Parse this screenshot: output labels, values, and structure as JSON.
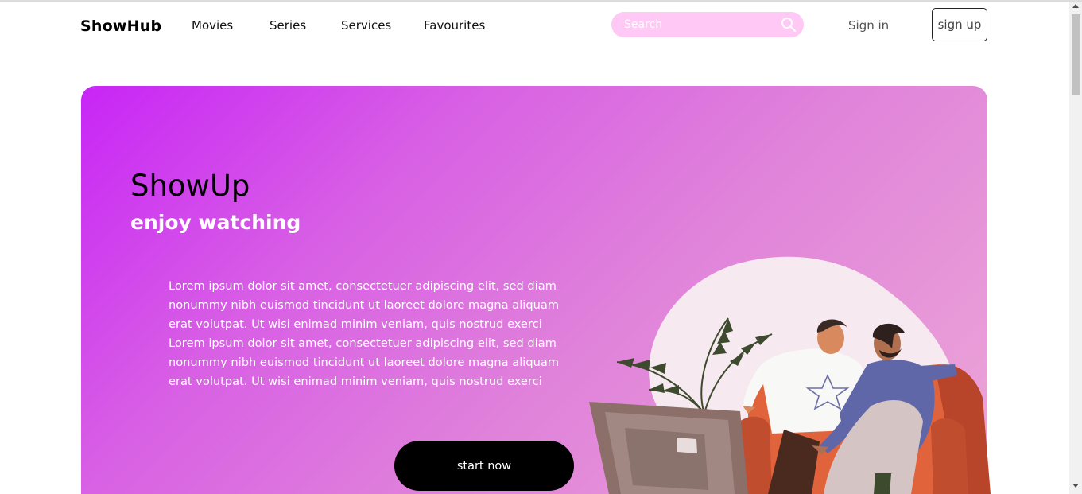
{
  "header": {
    "logo": "ShowHub",
    "nav": [
      {
        "label": "Movies"
      },
      {
        "label": "Series"
      },
      {
        "label": "Services"
      },
      {
        "label": "Favourites"
      }
    ],
    "search": {
      "placeholder": "Search",
      "value": "",
      "icon": "search-icon"
    },
    "signin_label": "Sign in",
    "signup_label": "sign up"
  },
  "hero": {
    "title": "ShowUp",
    "subtitle": "enjoy watching",
    "body": "Lorem ipsum dolor sit amet, consectetuer adipiscing elit, sed diam nonummy nibh euismod tincidunt ut laoreet dolore magna aliquam erat volutpat. Ut wisi enimad minim veniam, quis nostrud exerci Lorem ipsum dolor sit amet, consectetuer adipiscing elit, sed diam nonummy nibh euismod tincidunt ut laoreet dolore magna aliquam erat volutpat. Ut wisi enimad minim veniam, quis nostrud exerci",
    "cta_label": "start now"
  },
  "colors": {
    "search_bg": "#ffc8f5",
    "hero_gradient_start": "#c825f6",
    "hero_gradient_end": "#eda8d6",
    "cta_bg": "#000000"
  }
}
